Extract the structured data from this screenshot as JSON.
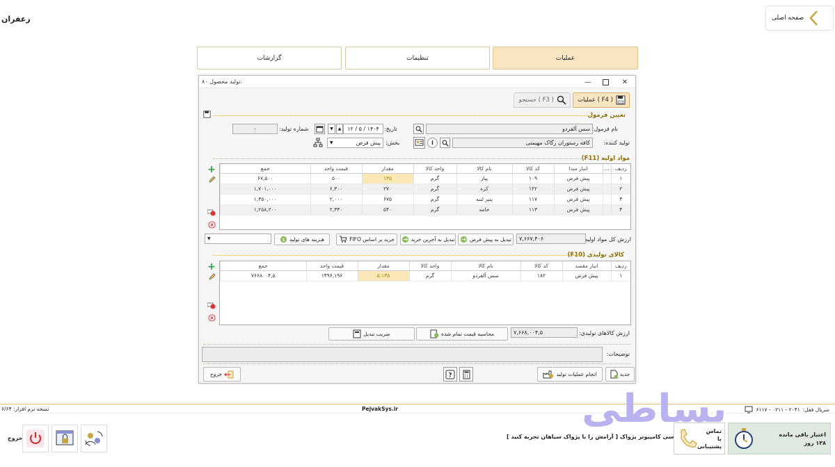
{
  "app": {
    "title": "زعفران",
    "home_label": "صفحه اصلی"
  },
  "tabs": [
    {
      "label": "عملیات"
    },
    {
      "label": "تنظیمات"
    },
    {
      "label": "گزارشات"
    }
  ],
  "dialog": {
    "title": "تولید محصول ۸۰.",
    "tab_ops": "عملیات ( F4 )",
    "tab_search": "جستجو ( F3 )",
    "formula_section": "تعیین فرمول",
    "formula_label": "نام فرمول:",
    "formula_value": "سس آلفردو",
    "date_label": "تاریخ:",
    "date_value": "۱۴۰۴ / ۵ / ۱۲",
    "prod_no_label": "شماره تولید:",
    "prod_no_value": "۰",
    "producer_label": "تولید کننده:",
    "producer_value": "کافه رستوران رگاک مهیمنی",
    "section_label": "بخش:",
    "section_value": "پیش فرض",
    "raw_section": "مواد اولیه (F11)",
    "raw_columns": [
      "ردیف",
      "...",
      "انبار مبدا",
      "کد کالا",
      "نام کالا",
      "واحد کالا",
      "مقدار",
      "قیمت واحد",
      "جمع"
    ],
    "raw_rows": [
      [
        "۱",
        "پیش فرض",
        "۱۰۹",
        "پیاز",
        "گرم",
        "۱۳۵",
        "۵۰۰",
        "۶۷,۵۰۰"
      ],
      [
        "۲",
        "پیش فرض",
        "۱۲۲",
        "کره",
        "گرم",
        "۲۷۰",
        "۶,۳۰۰",
        "۱,۷۰۱,۰۰۰"
      ],
      [
        "۳",
        "پیش فرض",
        "۱۱۷",
        "پنیر لبنه",
        "گرم",
        "۶۷۵",
        "۲,۰۰۰",
        "۱,۳۵۰,۰۰۰"
      ],
      [
        "۴",
        "پیش فرض",
        "۱۱۳",
        "خامه",
        "گرم",
        "۵۴۰",
        "۲,۳۳۰",
        "۱,۲۵۸,۲۰۰"
      ]
    ],
    "raw_total_label": "ارزش کل مواد اولیه:",
    "raw_total_value": "۷,۶۶۷,۴۰۶",
    "btn_default": "تبدیل به پیش فرض",
    "btn_latest": "تبدیل به آخرین خرید",
    "btn_fifo": "خرید بر اساس FIFO",
    "btn_costs": "هـزینه های تولید",
    "prod_section": "کالای تولیدی (F10)",
    "prod_columns": [
      "ردیف",
      "انبار مقصد",
      "کد کالا",
      "نام کالا",
      "واحد کالا",
      "مقدار",
      "قیمت واحد",
      "جمع"
    ],
    "prod_rows": [
      [
        "۱",
        "پیش فرض",
        "۱۸۲",
        "سس آلفردو",
        "گرم",
        "۵.۱۳۵",
        "۱۴۹۶,۱۹۶",
        "۷۶۶۸۰۰۴,۵"
      ]
    ],
    "prod_total_label": "ارزش کالاهای تولیدی:",
    "prod_total_value": "۷,۶۶۸,۰۰۴,۵",
    "btn_calc": "محاسبه قیمت تمام شده",
    "btn_factor": "ضریب تبدیل",
    "desc_label": "توضیحات:",
    "btn_new": "جدید",
    "btn_run": "انجام عملیات تولید",
    "btn_exit": "خروج"
  },
  "footer": {
    "version": "نسخه نرم افزار: ۶/۶۴",
    "site": "PejvakSys.ir",
    "serial_label": "سریال قفل:",
    "serial_value": "۲۰۴۱ - ۰۲۱۱ - ۶۱۱۷",
    "exit_label": "خروج",
    "company": "شرکت مهندسی کامپیوتر پژواک [ آرامش را با پژواک سیاهان تجربه کنید ]",
    "support": "تماس با پشتیبانی",
    "credit_label": "اعتبار باقی مانده",
    "credit_value": "۱۳۸ روز",
    "watermark": "بساطی"
  },
  "colors": {
    "accent": "#f8e5c2",
    "gold": "#d5b350",
    "highlight": "#fbe8b8"
  }
}
